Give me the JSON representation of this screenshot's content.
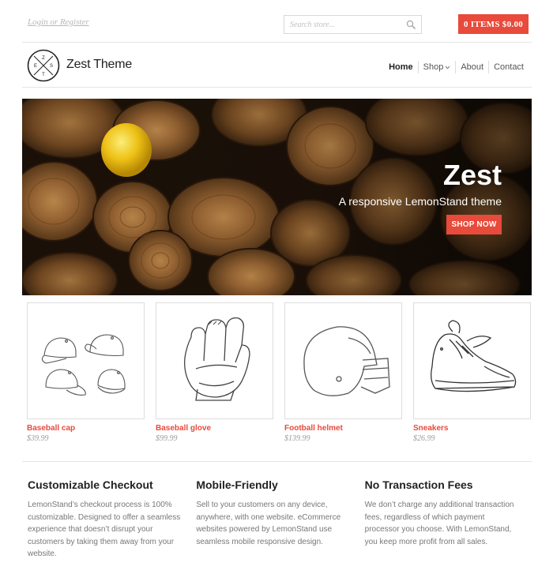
{
  "topbar": {
    "login_label": "Login or Register",
    "search_placeholder": "Search store...",
    "cart_label": "0 ITEMS $0.00"
  },
  "header": {
    "brand": "Zest Theme",
    "logo_letters": [
      "Z",
      "E",
      "S",
      "T"
    ],
    "nav": [
      {
        "label": "Home",
        "active": true
      },
      {
        "label": "Shop",
        "has_dropdown": true
      },
      {
        "label": "About"
      },
      {
        "label": "Contact"
      }
    ]
  },
  "hero": {
    "title": "Zest",
    "subtitle": "A responsive LemonStand theme",
    "cta": "SHOP NOW"
  },
  "products": [
    {
      "name": "Baseball cap",
      "price": "$39.99",
      "icon": "baseball-cap-icon"
    },
    {
      "name": "Baseball glove",
      "price": "$99.99",
      "icon": "baseball-glove-icon"
    },
    {
      "name": "Football helmet",
      "price": "$139.99",
      "icon": "football-helmet-icon"
    },
    {
      "name": "Sneakers",
      "price": "$26.99",
      "icon": "sneaker-icon"
    }
  ],
  "features": [
    {
      "title": "Customizable Checkout",
      "text": "LemonStand’s checkout process is 100% customizable. Designed to offer a seamless experience that doesn’t disrupt your customers by taking them away from your website."
    },
    {
      "title": "Mobile-Friendly",
      "text": "Sell to your customers on any device, anywhere, with one website. eCommerce websites powered by LemonStand use seamless mobile responsive design."
    },
    {
      "title": "No Transaction Fees",
      "text": "We don’t charge any additional transaction fees, regardless of which payment processor you choose. With LemonStand, you keep more profit from all sales."
    }
  ],
  "colors": {
    "accent": "#e84a3b",
    "text": "#333333",
    "muted": "#777777"
  }
}
